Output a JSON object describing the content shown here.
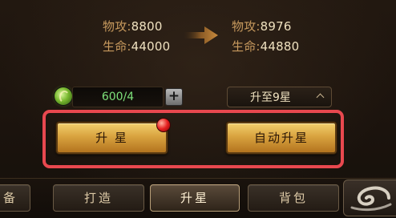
{
  "stats": {
    "before": {
      "attack_label": "物攻",
      "attack_value": "8800",
      "hp_label": "生命",
      "hp_value": "44000"
    },
    "after": {
      "attack_label": "物攻",
      "attack_value": "8976",
      "hp_label": "生命",
      "hp_value": "44880"
    },
    "separator": ":"
  },
  "resource": {
    "icon": "green-orb-icon",
    "count": "600/4",
    "plus_label": "+"
  },
  "target_select": {
    "label": "升至9星"
  },
  "buttons": {
    "upgrade_star": "升 星",
    "auto_upgrade_star": "自动升星"
  },
  "tabs": [
    {
      "label": "备",
      "active": false
    },
    {
      "label": "打造",
      "active": false
    },
    {
      "label": "升星",
      "active": true
    },
    {
      "label": "背包",
      "active": false
    }
  ],
  "colors": {
    "highlight_frame": "#e8484f",
    "count_text": "#7de07a",
    "gold_button": "#d9a33f",
    "notification_dot": "#e51f1f"
  }
}
